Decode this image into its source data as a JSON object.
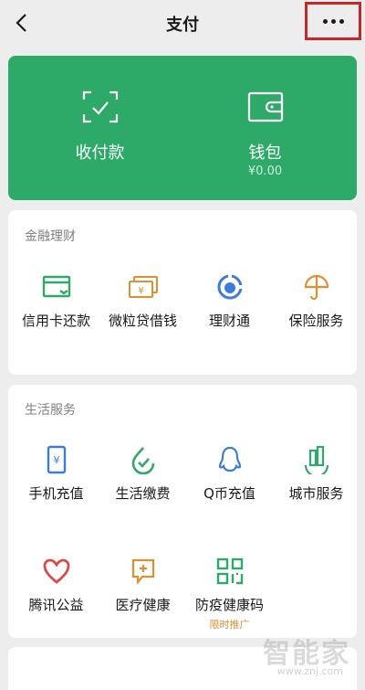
{
  "navbar": {
    "title": "支付"
  },
  "hero": {
    "items": [
      {
        "label": "收付款",
        "icon": "scan-qr-icon"
      },
      {
        "label": "钱包",
        "sub": "¥0.00",
        "icon": "wallet-icon"
      }
    ],
    "color": "#2daa67"
  },
  "finance": {
    "title": "金融理财",
    "items": [
      {
        "label": "信用卡还款",
        "icon": "credit-card-icon",
        "color": "#2daa67"
      },
      {
        "label": "微粒贷借钱",
        "icon": "loan-icon",
        "color": "#e0902f"
      },
      {
        "label": "理财通",
        "icon": "wealth-icon",
        "color": "#3b7dd8"
      },
      {
        "label": "保险服务",
        "icon": "insurance-icon",
        "color": "#e0902f"
      }
    ]
  },
  "life": {
    "title": "生活服务",
    "items": [
      {
        "label": "手机充值",
        "icon": "mobile-topup-icon",
        "color": "#3b7dd8"
      },
      {
        "label": "生活缴费",
        "icon": "utility-bill-icon",
        "color": "#2daa67"
      },
      {
        "label": "Q币充值",
        "icon": "qq-coin-icon",
        "color": "#3b7dd8"
      },
      {
        "label": "城市服务",
        "icon": "city-service-icon",
        "color": "#2daa67"
      },
      {
        "label": "腾讯公益",
        "icon": "charity-heart-icon",
        "color": "#e04848"
      },
      {
        "label": "医疗健康",
        "icon": "medical-icon",
        "color": "#e0902f"
      },
      {
        "label": "防疫健康码",
        "icon": "health-qr-icon",
        "color": "#2daa67",
        "tag": "限时推广"
      }
    ]
  },
  "watermark": {
    "text": "智能家",
    "url": "www.znj.com"
  }
}
